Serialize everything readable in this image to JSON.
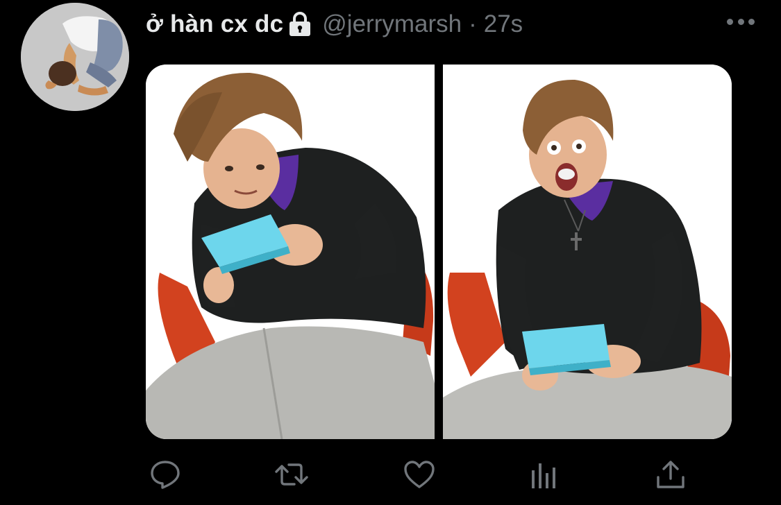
{
  "tweet": {
    "display_name": "ở hàn cx dc",
    "handle": "@jerrymarsh",
    "separator": "·",
    "timestamp": "27s",
    "protected_icon": "lock-icon",
    "more_icon": "more-options-icon"
  },
  "media": {
    "photos": [
      {
        "name": "photo-left-calm"
      },
      {
        "name": "photo-right-shocked"
      }
    ]
  },
  "actions": [
    {
      "name": "reply-button",
      "icon": "reply-icon"
    },
    {
      "name": "retweet-button",
      "icon": "retweet-icon"
    },
    {
      "name": "like-button",
      "icon": "heart-icon"
    },
    {
      "name": "analytics-button",
      "icon": "analytics-icon"
    },
    {
      "name": "share-button",
      "icon": "share-icon"
    }
  ],
  "colors": {
    "background": "#000000",
    "primary_text": "#e7e9ea",
    "secondary_text": "#71767b"
  }
}
